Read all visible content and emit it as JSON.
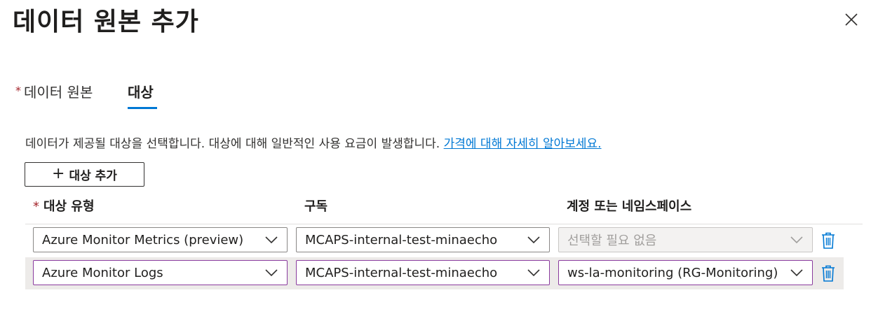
{
  "panel": {
    "title": "데이터 원본 추가",
    "close_icon": "close-icon"
  },
  "tabs": [
    {
      "label": "데이터 원본",
      "required_marker": "*",
      "selected": false
    },
    {
      "label": "대상",
      "selected": true
    }
  ],
  "description": {
    "text": "데이터가 제공될 대상을 선택합니다. 대상에 대해 일반적인 사용 요금이 발생합니다. ",
    "link": "가격에 대해 자세히 알아보세요."
  },
  "add_button": {
    "icon": "plus-icon",
    "label": "대상 추가"
  },
  "columns": {
    "type": {
      "label": "대상 유형",
      "required_marker": "*"
    },
    "subscription": {
      "label": "구독"
    },
    "account": {
      "label": "계정 또는 네임스페이스"
    }
  },
  "rows": [
    {
      "type": "Azure Monitor Metrics (preview)",
      "subscription": "MCAPS-internal-test-minaecho",
      "account": "선택할 필요 없음",
      "account_disabled": true,
      "delete_icon": "trash-icon"
    },
    {
      "type": "Azure Monitor Logs",
      "subscription": "MCAPS-internal-test-minaecho",
      "account": "ws-la-monitoring (RG-Monitoring)",
      "account_disabled": false,
      "delete_icon": "trash-icon"
    }
  ],
  "colors": {
    "accent": "#0078d4",
    "required": "#a4262c",
    "selected_row_bg": "#edebe9",
    "focus_border": "#8a3b9e"
  }
}
